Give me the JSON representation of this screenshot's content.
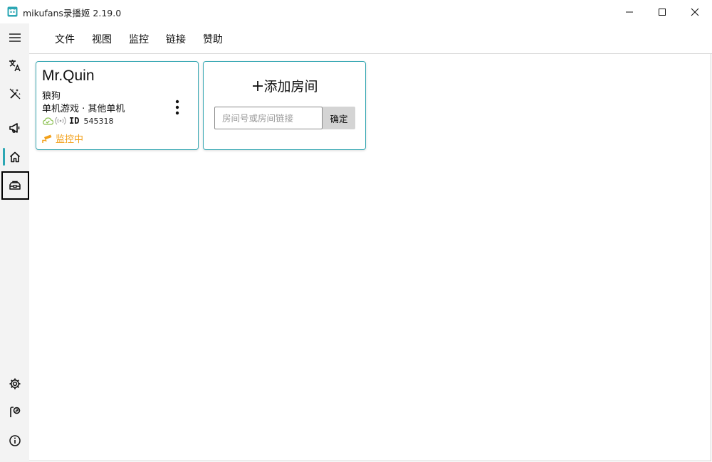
{
  "window": {
    "title": "mikufans录播姬 2.19.0",
    "icon": "mikufans-app-icon",
    "controls": [
      "minimize-icon",
      "maximize-icon",
      "close-icon"
    ]
  },
  "colors": {
    "accent": "#2ca7b4",
    "card_border": "#3aa9b4",
    "status_monitoring": "#f2a01a",
    "cloud_online": "#8cc152"
  },
  "sidebar": {
    "items": [
      {
        "icon": "menu-icon"
      },
      {
        "icon": "translate-icon"
      },
      {
        "icon": "magic-wand-off-icon"
      },
      {
        "icon": "megaphone-icon"
      },
      {
        "icon": "home-icon",
        "active": true
      },
      {
        "icon": "toolbox-icon",
        "focused": true
      },
      {
        "icon": "gear-icon"
      },
      {
        "icon": "parking-sign-icon"
      },
      {
        "icon": "info-icon"
      }
    ]
  },
  "menu": {
    "items": [
      {
        "label": "文件"
      },
      {
        "label": "视图"
      },
      {
        "label": "监控"
      },
      {
        "label": "链接"
      },
      {
        "label": "赞助"
      }
    ]
  },
  "room_card": {
    "name": "Mr.Quin",
    "subtitle": "狼狗",
    "category": "单机游戏 · 其他单机",
    "id_label": "ID",
    "id_value": "545318",
    "status": "监控中",
    "icons": [
      "cloud-check-icon",
      "broadcast-icon",
      "cctv-camera-icon",
      "more-vertical-icon"
    ]
  },
  "add_room": {
    "title": "添加房间",
    "input_placeholder": "房间号或房间链接",
    "input_value": "",
    "confirm_label": "确定"
  }
}
